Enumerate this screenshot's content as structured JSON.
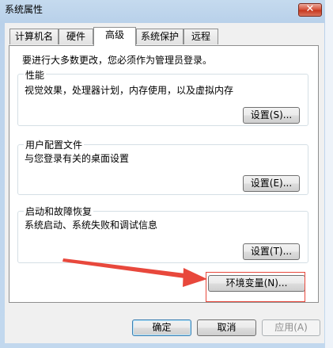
{
  "window": {
    "title": "系统属性",
    "close_glyph": "✕"
  },
  "tabs": [
    {
      "label": "计算机名",
      "active": false
    },
    {
      "label": "硬件",
      "active": false
    },
    {
      "label": "高级",
      "active": true
    },
    {
      "label": "系统保护",
      "active": false
    },
    {
      "label": "远程",
      "active": false
    }
  ],
  "advanced": {
    "admin_notice": "要进行大多数更改，您必须作为管理员登录。",
    "performance": {
      "label": "性能",
      "description": "视觉效果，处理器计划，内存使用，以及虚拟内存",
      "button": "设置(S)..."
    },
    "user_profiles": {
      "label": "用户配置文件",
      "description": "与您登录有关的桌面设置",
      "button": "设置(E)..."
    },
    "startup_recovery": {
      "label": "启动和故障恢复",
      "description": "系统启动、系统失败和调试信息",
      "button": "设置(T)..."
    },
    "env_vars_button": "环境变量(N)..."
  },
  "footer": {
    "ok": "确定",
    "cancel": "取消",
    "apply": "应用(A)"
  },
  "annotation": {
    "color": "#e8483c"
  }
}
